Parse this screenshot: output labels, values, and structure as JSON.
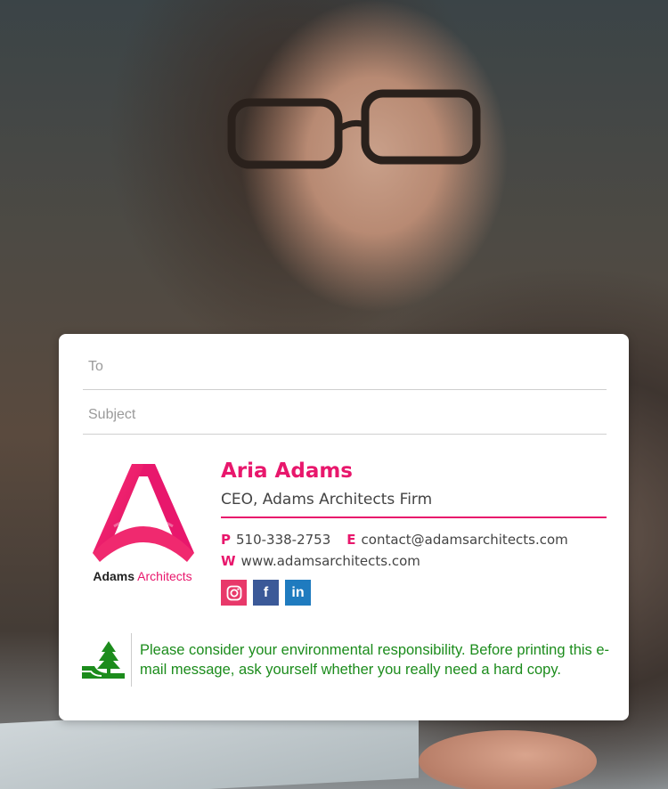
{
  "compose": {
    "to_placeholder": "To",
    "subject_placeholder": "Subject"
  },
  "signature": {
    "logo": {
      "word1": "Adams",
      "word2": "Architects"
    },
    "name": "Aria Adams",
    "title": "CEO, Adams Architects Firm",
    "phone_label": "P",
    "phone": "510-338-2753",
    "email_label": "E",
    "email": "contact@adamsarchitects.com",
    "web_label": "W",
    "website": "www.adamsarchitects.com",
    "social": {
      "instagram_icon": "instagram-icon",
      "facebook_glyph": "f",
      "linkedin_glyph": "in"
    },
    "accent_color": "#e8176c"
  },
  "eco_notice": {
    "text": "Please consider your environmental responsibility. Before printing this e-mail message, ask yourself whether you really need a hard copy.",
    "color": "#1c8c1c"
  }
}
